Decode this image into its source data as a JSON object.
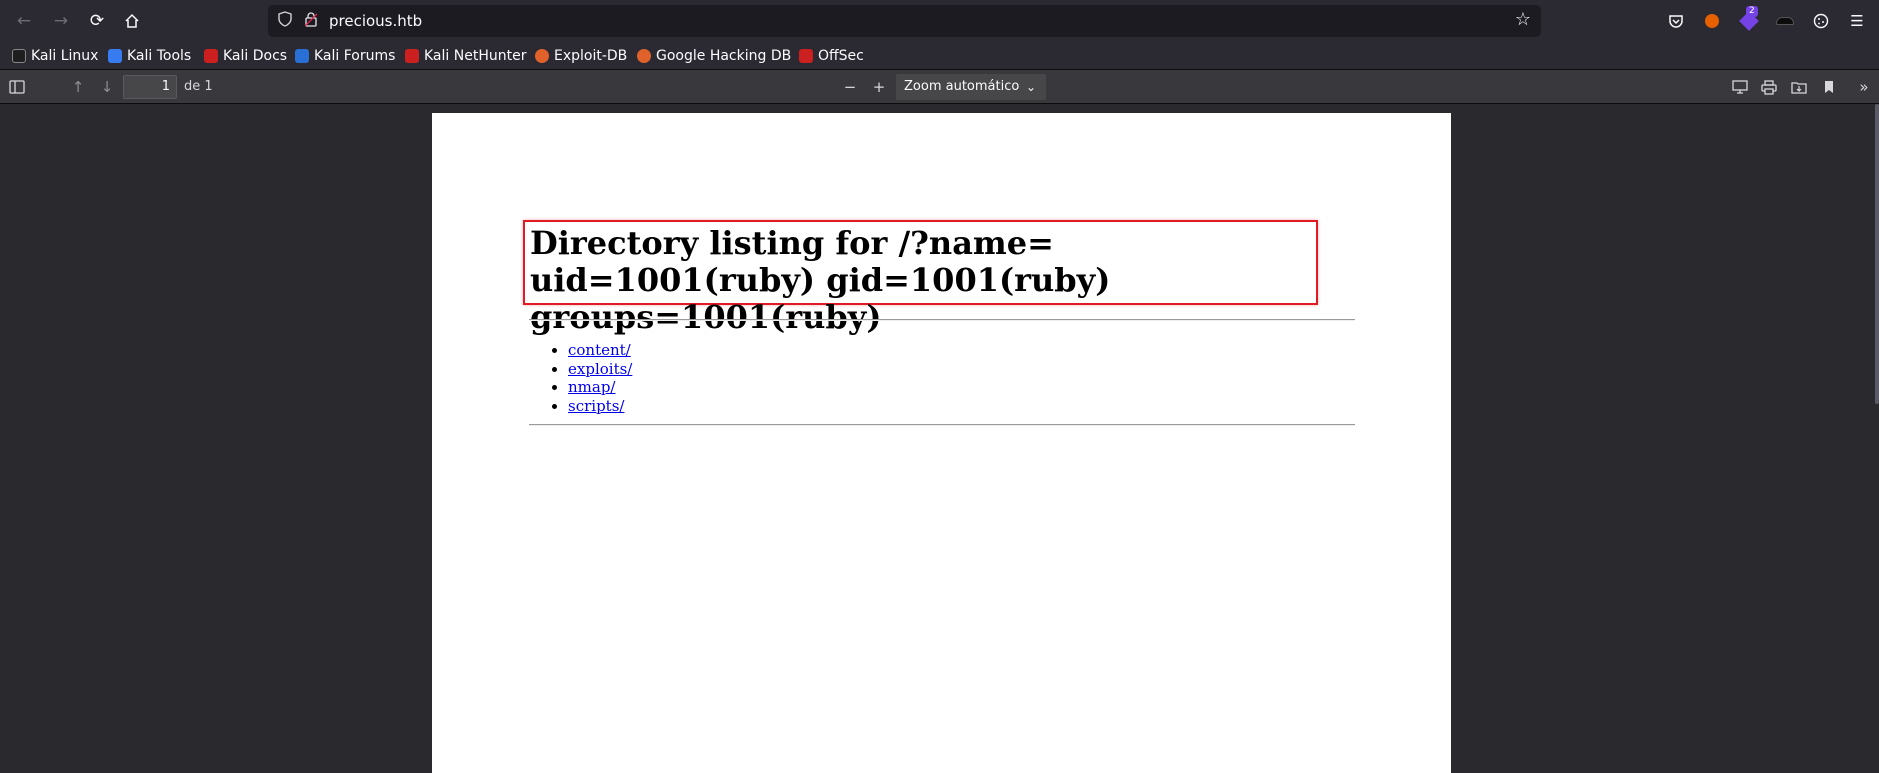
{
  "browser": {
    "url": "precious.htb",
    "extension_badge": "2"
  },
  "bookmarks": [
    {
      "label": "Kali Linux",
      "color": "#000000"
    },
    {
      "label": "Kali Tools",
      "color": "#367bf0"
    },
    {
      "label": "Kali Docs",
      "color": "#cc1f1f"
    },
    {
      "label": "Kali Forums",
      "color": "#2a6fd6"
    },
    {
      "label": "Kali NetHunter",
      "color": "#cc1f1f"
    },
    {
      "label": "Exploit-DB",
      "color": "#e0622a"
    },
    {
      "label": "Google Hacking DB",
      "color": "#e0622a"
    },
    {
      "label": "OffSec",
      "color": "#cc1f1f"
    }
  ],
  "pdf_toolbar": {
    "page_number": "1",
    "page_count_label": "de 1",
    "zoom": "Zoom automático"
  },
  "document": {
    "heading": "Directory listing for /?name= uid=1001(ruby) gid=1001(ruby) groups=1001(ruby)",
    "entries": [
      "content/",
      "exploits/",
      "nmap/",
      "scripts/"
    ],
    "highlight_color": "#e01b24"
  }
}
